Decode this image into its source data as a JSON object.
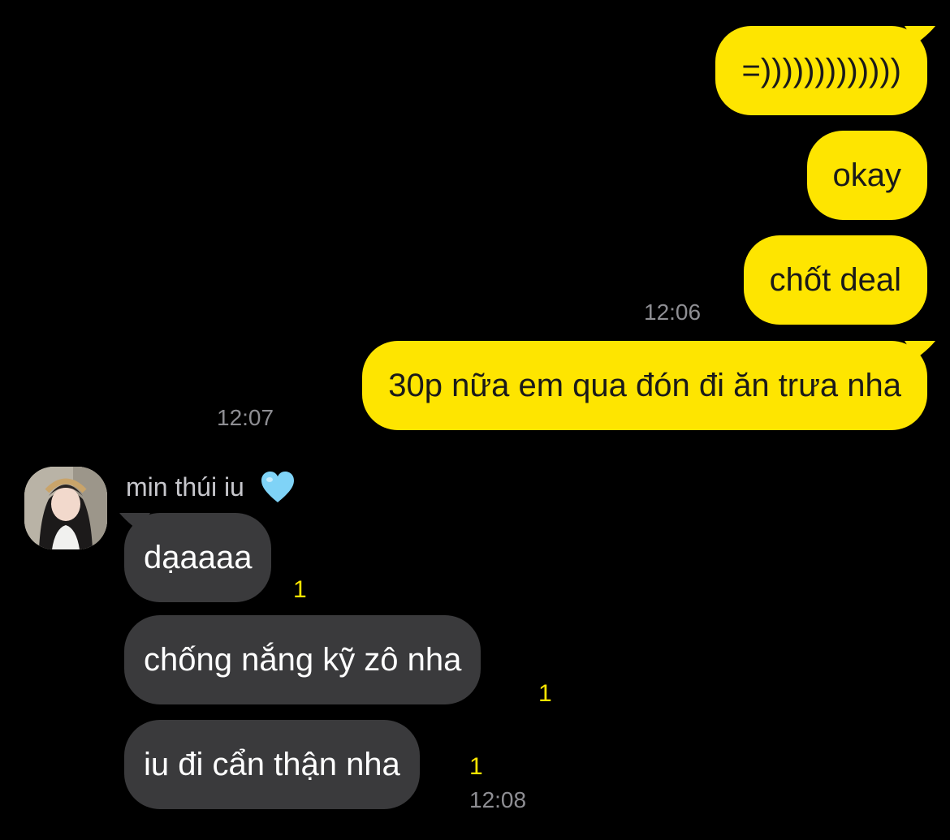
{
  "sent_messages": [
    {
      "text": "=)))))))))))))",
      "time": ""
    },
    {
      "text": "okay",
      "time": ""
    },
    {
      "text": "chốt deal",
      "time": "12:06"
    },
    {
      "text": "30p nữa em qua đón đi ăn trưa nha",
      "time": "12:07"
    }
  ],
  "received": {
    "sender_name": "min thúi iu",
    "sender_emoji_icon": "light-blue-heart-icon",
    "messages": [
      {
        "text": "dạaaaa",
        "unread": "1",
        "time": ""
      },
      {
        "text": "chống nắng kỹ zô nha",
        "unread": "1",
        "time": ""
      },
      {
        "text": "iu đi cẩn thận nha",
        "unread": "1",
        "time": "12:08"
      }
    ]
  },
  "colors": {
    "background": "#000000",
    "sent_bubble": "#FEE500",
    "received_bubble": "#3a3a3c",
    "unread_count": "#FEE500",
    "timestamp": "#8e8e93"
  }
}
